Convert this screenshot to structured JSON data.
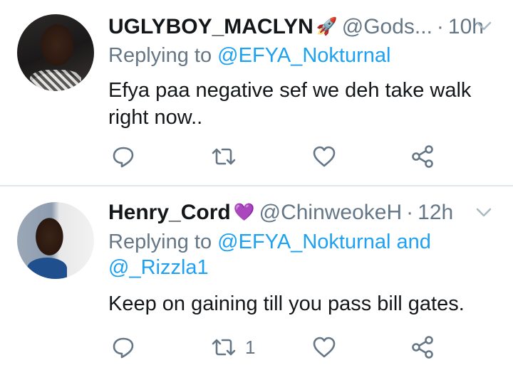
{
  "tweets": [
    {
      "name": "UGLYBOY_MACLYN",
      "emoji": "🚀",
      "handle": "@Gods...",
      "dot": "·",
      "time": "10h",
      "replying_prefix": "Replying to",
      "mentions": [
        "@EFYA_Nokturnal"
      ],
      "text": "Efya paa negative sef we deh take walk right now..",
      "retweet_count": ""
    },
    {
      "name": "Henry_Cord",
      "emoji": "💜",
      "handle": "@ChinweokeH",
      "dot": "·",
      "time": "12h",
      "replying_prefix": "Replying to",
      "mentions": [
        "@EFYA_Nokturnal",
        "@_Rizzla1"
      ],
      "mention_joiner": "and",
      "text": "Keep on gaining till you pass bill gates.",
      "retweet_count": "1"
    }
  ],
  "colors": {
    "link": "#1da1f2",
    "muted": "#657786",
    "text": "#14171a",
    "divider": "#e1e8ed"
  },
  "icons": [
    "reply-icon",
    "retweet-icon",
    "like-icon",
    "share-icon",
    "chevron-down-icon"
  ]
}
